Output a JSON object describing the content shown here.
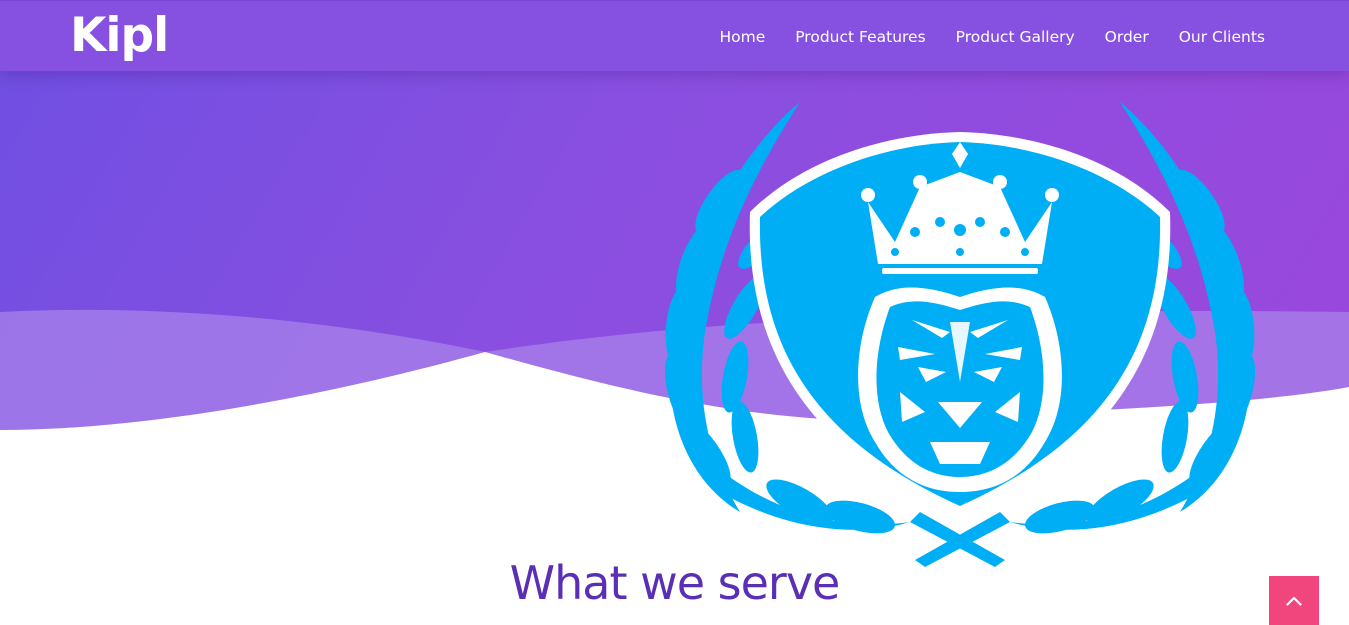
{
  "brand": {
    "name": "Kipl"
  },
  "nav": {
    "items": [
      {
        "label": "Home"
      },
      {
        "label": "Product Features"
      },
      {
        "label": "Product Gallery"
      },
      {
        "label": "Order"
      },
      {
        "label": "Our Clients"
      }
    ]
  },
  "hero": {
    "emblem_icon": "tiger-crest-with-crown-and-laurel-icon"
  },
  "section": {
    "title": "What we serve"
  },
  "back_to_top": {
    "icon": "chevron-up-icon"
  },
  "colors": {
    "hero_gradient_start": "#6f4fe2",
    "hero_gradient_end": "#9a47dc",
    "nav_background": "#8650e0",
    "emblem": "#00aef5",
    "section_title": "#5a2fb5",
    "back_to_top": "#f0457d"
  }
}
